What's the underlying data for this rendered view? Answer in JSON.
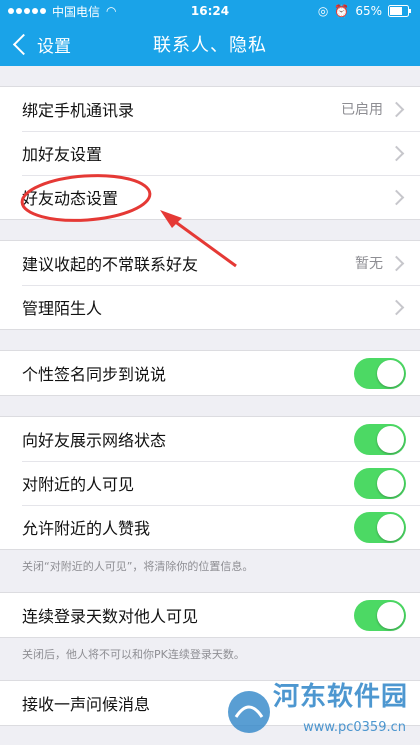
{
  "status": {
    "carrier": "中国电信",
    "time": "16:24",
    "battery": "65%"
  },
  "nav": {
    "back_label": "设置",
    "title": "联系人、隐私"
  },
  "group1": [
    {
      "label": "绑定手机通讯录",
      "value": "已启用"
    },
    {
      "label": "加好友设置",
      "value": ""
    },
    {
      "label": "好友动态设置",
      "value": ""
    }
  ],
  "group2": [
    {
      "label": "建议收起的不常联系好友",
      "value": "暂无"
    },
    {
      "label": "管理陌生人",
      "value": ""
    }
  ],
  "group3": [
    {
      "label": "个性签名同步到说说",
      "on": true
    }
  ],
  "group4": [
    {
      "label": "向好友展示网络状态",
      "on": true
    },
    {
      "label": "对附近的人可见",
      "on": true
    },
    {
      "label": "允许附近的人赞我",
      "on": true
    }
  ],
  "note4": "关闭“对附近的人可见”，将清除你的位置信息。",
  "group5": [
    {
      "label": "连续登录天数对他人可见",
      "on": true
    }
  ],
  "note5": "关闭后，他人将不可以和你PK连续登录天数。",
  "group6": [
    {
      "label": "接收一声问候消息"
    }
  ],
  "watermark": {
    "name": "河东软件园",
    "url": "www.pc0359.cn"
  },
  "colors": {
    "accent": "#1aa3e8",
    "toggle_on": "#4cd964",
    "annotation": "#e53935"
  }
}
